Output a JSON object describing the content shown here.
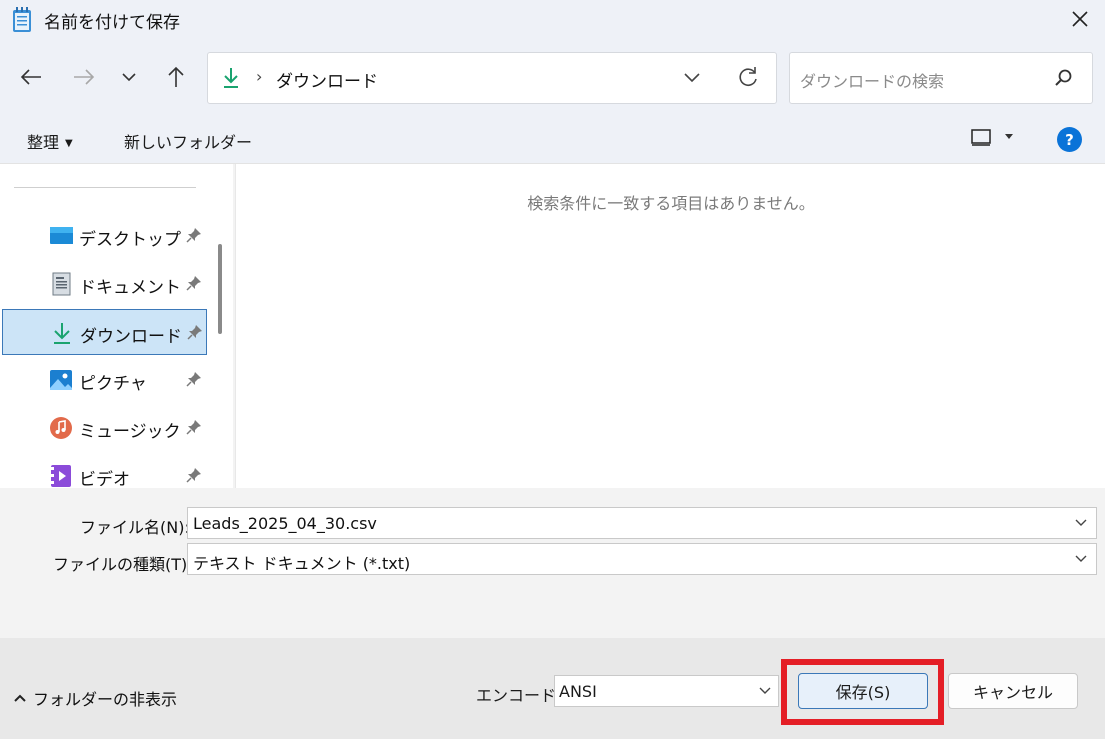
{
  "window": {
    "title": "名前を付けて保存"
  },
  "address": {
    "path": "ダウンロード",
    "separator": "›"
  },
  "search": {
    "placeholder": "ダウンロードの検索"
  },
  "toolbar": {
    "organize": "整理",
    "new_folder": "新しいフォルダー"
  },
  "sidebar": {
    "items": [
      {
        "label": "デスクトップ",
        "icon": "desktop-icon"
      },
      {
        "label": "ドキュメント",
        "icon": "document-icon"
      },
      {
        "label": "ダウンロード",
        "icon": "download-icon",
        "selected": true
      },
      {
        "label": "ピクチャ",
        "icon": "pictures-icon"
      },
      {
        "label": "ミュージック",
        "icon": "music-icon"
      },
      {
        "label": "ビデオ",
        "icon": "video-icon"
      }
    ]
  },
  "content": {
    "empty_message": "検索条件に一致する項目はありません。"
  },
  "form": {
    "filename_label": "ファイル名(N):",
    "filename_value": "Leads_2025_04_30.csv",
    "filetype_label": "ファイルの種類(T):",
    "filetype_value": "テキスト ドキュメント (*.txt)"
  },
  "footer": {
    "hide_folders": "フォルダーの非表示",
    "encoding_label": "エンコード:",
    "encoding_value": "ANSI",
    "save_label": "保存(S)",
    "cancel_label": "キャンセル"
  },
  "colors": {
    "accent": "#0a73d8",
    "highlight": "#e41e26",
    "selection": "#cce4f7"
  }
}
